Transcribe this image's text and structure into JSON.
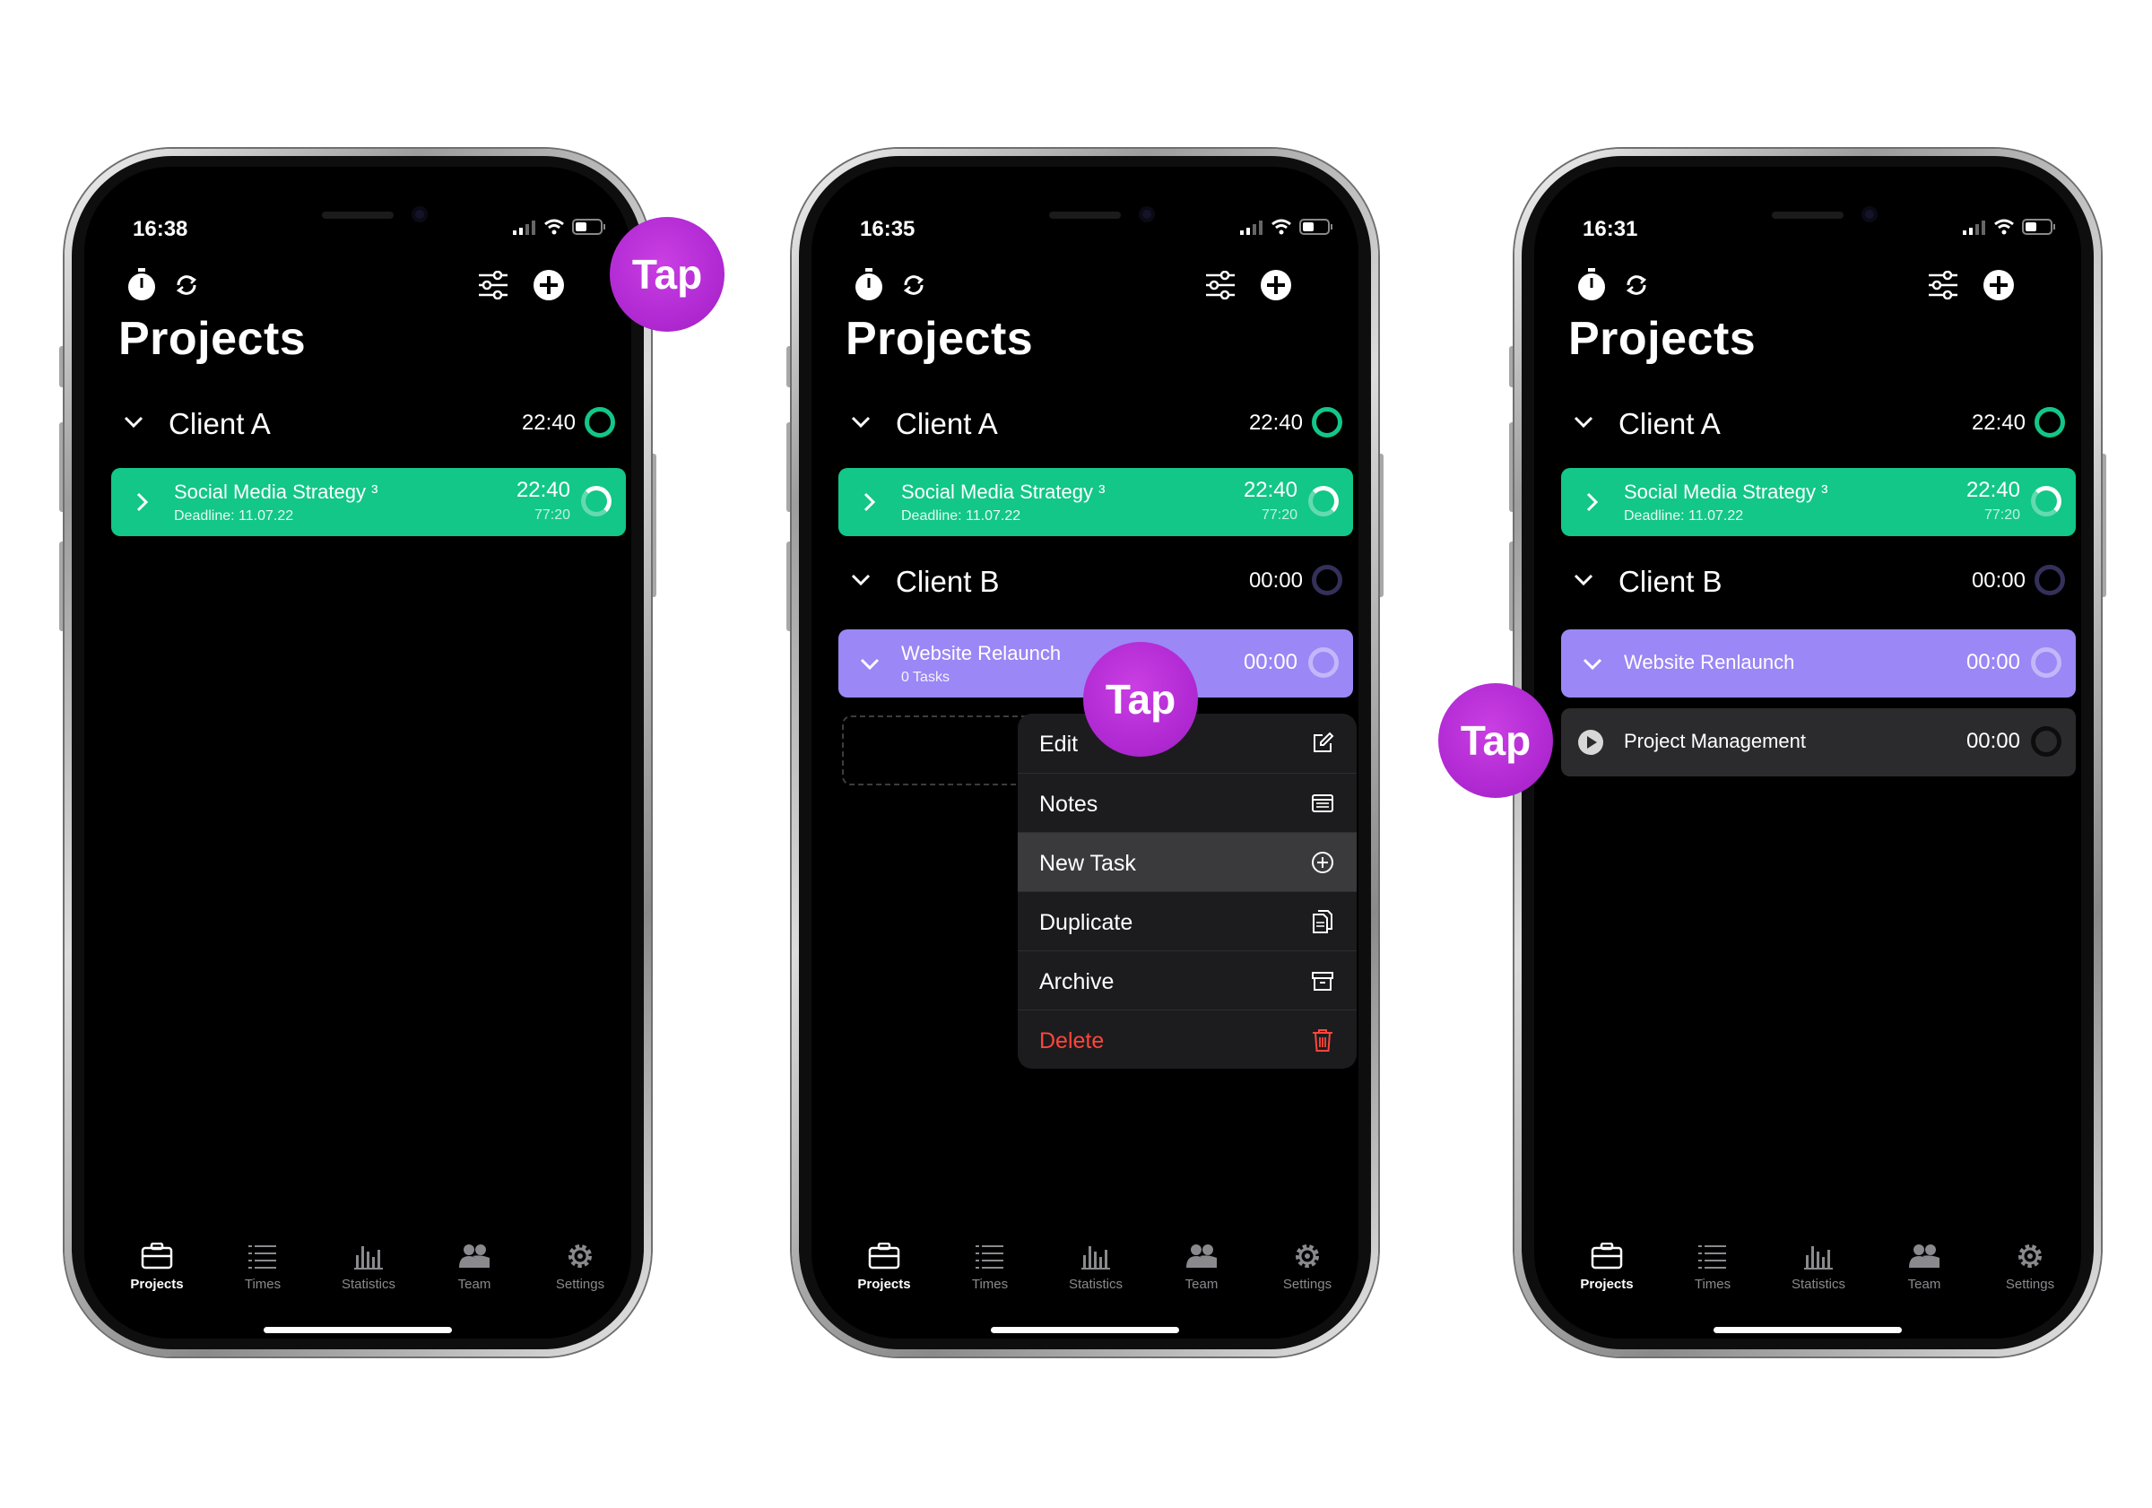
{
  "colors": {
    "green": "#12c788",
    "purple": "#9b87f5",
    "tap": "#b22ad3",
    "delete": "#ff453a",
    "gray_row": "#2b2b2d",
    "menu_bg": "#1c1c1e",
    "menu_highlight": "#3a3a3c"
  },
  "phones": [
    {
      "status_time": "16:38",
      "page_title": "Projects",
      "groups": [
        {
          "name": "Client A",
          "time": "22:40"
        }
      ],
      "projects": [
        {
          "name": "Social Media Strategy ³",
          "subtitle": "Deadline: 11.07.22",
          "time": "22:40",
          "subtime": "77:20"
        }
      ],
      "tap_label": "Tap",
      "tabs": [
        "Projects",
        "Times",
        "Statistics",
        "Team",
        "Settings"
      ]
    },
    {
      "status_time": "16:35",
      "page_title": "Projects",
      "groups": [
        {
          "name": "Client A",
          "time": "22:40"
        },
        {
          "name": "Client B",
          "time": "00:00"
        }
      ],
      "projects": [
        {
          "name": "Social Media Strategy ³",
          "subtitle": "Deadline: 11.07.22",
          "time": "22:40",
          "subtime": "77:20"
        },
        {
          "name": "Website Relaunch",
          "subtitle": "0 Tasks",
          "time": "00:00"
        }
      ],
      "menu": [
        "Edit",
        "Notes",
        "New Task",
        "Duplicate",
        "Archive",
        "Delete"
      ],
      "tap_label": "Tap",
      "tabs": [
        "Projects",
        "Times",
        "Statistics",
        "Team",
        "Settings"
      ]
    },
    {
      "status_time": "16:31",
      "page_title": "Projects",
      "groups": [
        {
          "name": "Client A",
          "time": "22:40"
        },
        {
          "name": "Client B",
          "time": "00:00"
        }
      ],
      "projects": [
        {
          "name": "Social Media Strategy ³",
          "subtitle": "Deadline: 11.07.22",
          "time": "22:40",
          "subtime": "77:20"
        },
        {
          "name": "Website Renlaunch",
          "time": "00:00"
        }
      ],
      "tasks": [
        {
          "name": "Project Management",
          "time": "00:00"
        }
      ],
      "tap_label": "Tap",
      "tabs": [
        "Projects",
        "Times",
        "Statistics",
        "Team",
        "Settings"
      ]
    }
  ]
}
